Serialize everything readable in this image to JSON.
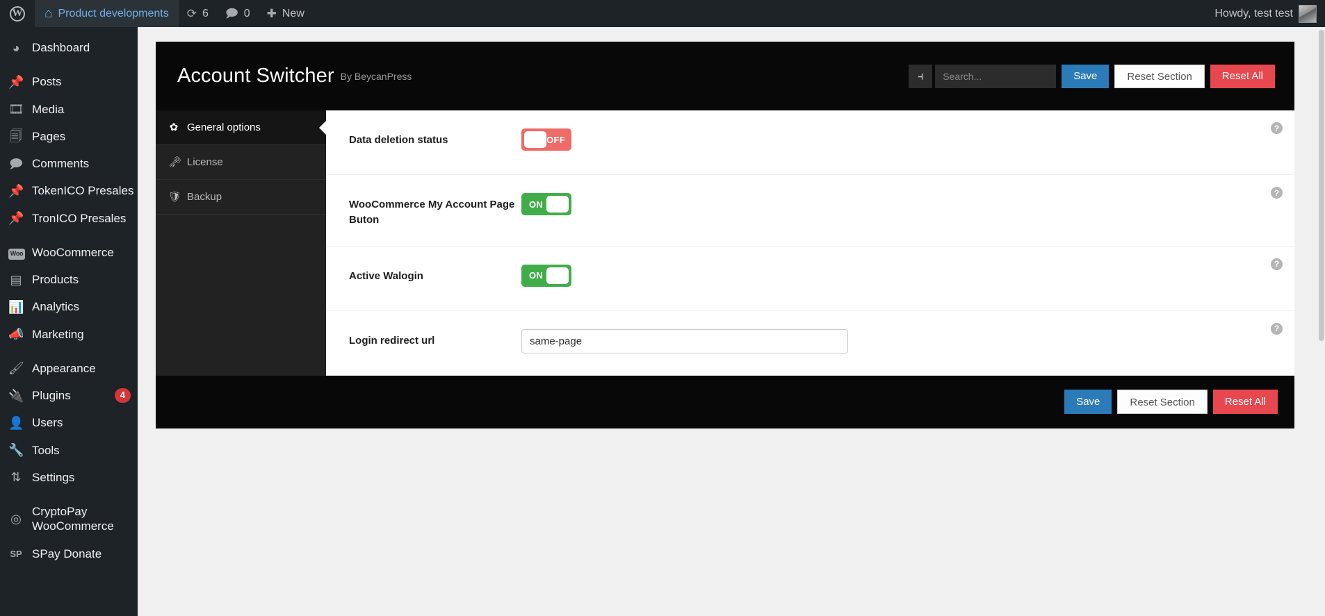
{
  "adminbar": {
    "wp_logo": "wordpress-logo",
    "site_name": "Product developments",
    "updates_count": "6",
    "comments_count": "0",
    "new_label": "New",
    "howdy": "Howdy, test test"
  },
  "adminmenu": {
    "items": [
      {
        "label": "Dashboard",
        "icon": "dashboard-icon",
        "glyph": "◴",
        "badge": ""
      },
      {
        "label": "Posts",
        "icon": "pin-icon",
        "glyph": "📌",
        "badge": ""
      },
      {
        "label": "Media",
        "icon": "media-icon",
        "glyph": "🖻",
        "badge": ""
      },
      {
        "label": "Pages",
        "icon": "pages-icon",
        "glyph": "🗐",
        "badge": ""
      },
      {
        "label": "Comments",
        "icon": "comment-icon",
        "glyph": "🗩",
        "badge": ""
      },
      {
        "label": "TokenICO Presales",
        "icon": "pin-icon",
        "glyph": "📌",
        "badge": ""
      },
      {
        "label": "TronICO Presales",
        "icon": "pin-icon",
        "glyph": "📌",
        "badge": ""
      },
      {
        "label": "WooCommerce",
        "icon": "woocommerce-icon",
        "glyph": "Woo",
        "badge": ""
      },
      {
        "label": "Products",
        "icon": "products-icon",
        "glyph": "▤",
        "badge": ""
      },
      {
        "label": "Analytics",
        "icon": "analytics-icon",
        "glyph": "▮▮▮",
        "badge": ""
      },
      {
        "label": "Marketing",
        "icon": "megaphone-icon",
        "glyph": "📢",
        "badge": ""
      },
      {
        "label": "Appearance",
        "icon": "brush-icon",
        "glyph": "🖌",
        "badge": ""
      },
      {
        "label": "Plugins",
        "icon": "plug-icon",
        "glyph": "🔌",
        "badge": "4"
      },
      {
        "label": "Users",
        "icon": "user-icon",
        "glyph": "👤",
        "badge": ""
      },
      {
        "label": "Tools",
        "icon": "wrench-icon",
        "glyph": "🔧",
        "badge": ""
      },
      {
        "label": "Settings",
        "icon": "settings-icon",
        "glyph": "⇅",
        "badge": ""
      },
      {
        "label": "CryptoPay WooCommerce",
        "icon": "cryptopay-icon",
        "glyph": "◎",
        "badge": ""
      },
      {
        "label": "SPay Donate",
        "icon": "spay-icon",
        "glyph": "SP",
        "badge": ""
      }
    ]
  },
  "panel": {
    "title": "Account Switcher",
    "author": "By BeycanPress",
    "collapse_icon": "collapse-sidebar-icon",
    "search_placeholder": "Search...",
    "search_value": "",
    "save_label": "Save",
    "reset_section_label": "Reset Section",
    "reset_all_label": "Reset All",
    "tabs": [
      {
        "label": "General options",
        "icon": "gear-icon",
        "glyph": "✿",
        "active": true
      },
      {
        "label": "License",
        "icon": "key-icon",
        "glyph": "🗝",
        "active": false
      },
      {
        "label": "Backup",
        "icon": "shield-icon",
        "glyph": "🛡",
        "active": false
      }
    ],
    "fields": [
      {
        "label": "Data deletion status",
        "type": "toggle",
        "state": "off",
        "state_label": "OFF",
        "help": "?"
      },
      {
        "label": "WooCommerce My Account Page Buton",
        "type": "toggle",
        "state": "on",
        "state_label": "ON",
        "help": "?"
      },
      {
        "label": "Active Walogin",
        "type": "toggle",
        "state": "on",
        "state_label": "ON",
        "help": "?"
      },
      {
        "label": "Login redirect url",
        "type": "text",
        "value": "same-page",
        "help": "?"
      }
    ],
    "footer": {
      "save_label": "Save",
      "reset_section_label": "Reset Section",
      "reset_all_label": "Reset All"
    }
  },
  "colors": {
    "accent_blue": "#2b7bb9",
    "danger_red": "#e7484f",
    "toggle_on_green": "#41ad49",
    "toggle_off_red": "#ee6b67",
    "admin_dark": "#1d2327",
    "panel_black": "#080808"
  }
}
